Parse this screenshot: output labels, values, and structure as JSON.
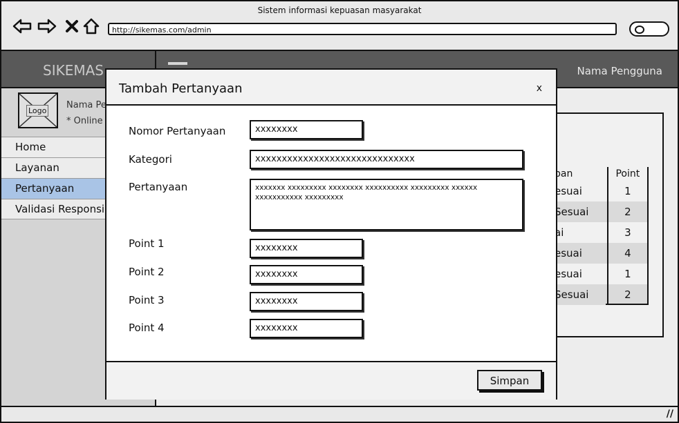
{
  "window": {
    "title": "Sistem informasi kepuasan masyarakat"
  },
  "browser": {
    "url": "http://sikemas.com/admin"
  },
  "header": {
    "brand": "SIKEMAS",
    "user_name": "Nama Pengguna"
  },
  "sidebar": {
    "logo_label": "Logo",
    "user_line1": "Nama Pengguna",
    "user_line2": "* Online",
    "items": [
      {
        "label": "Home",
        "active": false
      },
      {
        "label": "Layanan",
        "active": false
      },
      {
        "label": "Pertanyaan",
        "active": true
      },
      {
        "label": "Validasi Responsi",
        "active": false
      }
    ]
  },
  "table": {
    "headers": [
      "pan",
      "Point"
    ],
    "rows": [
      [
        "esuai",
        "1"
      ],
      [
        "Sesuai",
        "2"
      ],
      [
        "ai",
        "3"
      ],
      [
        "esuai",
        "4"
      ],
      [
        "esuai",
        "1"
      ],
      [
        "Sesuai",
        "2"
      ]
    ]
  },
  "modal": {
    "title": "Tambah Pertanyaan",
    "close": "x",
    "fields": {
      "nomor_label": "Nomor Pertanyaan",
      "nomor_value": "xxxxxxxx",
      "kategori_label": "Kategori",
      "kategori_value": "xxxxxxxxxxxxxxxxxxxxxxxxxxxxxx",
      "pertanyaan_label": "Pertanyaan",
      "pertanyaan_value": "xxxxxxx xxxxxxxxx xxxxxxxx xxxxxxxxxx xxxxxxxxx xxxxxx xxxxxxxxxxx xxxxxxxxx",
      "point1_label": "Point 1",
      "point1_value": "xxxxxxxx",
      "point2_label": "Point 2",
      "point2_value": "xxxxxxxx",
      "point3_label": "Point 3",
      "point3_value": "xxxxxxxx",
      "point4_label": "Point 4",
      "point4_value": "xxxxxxxx"
    },
    "save_label": "Simpan"
  },
  "icons": {
    "back": "arrow-left-icon",
    "forward": "arrow-right-icon",
    "stop": "close-icon",
    "home": "home-icon",
    "search": "search-icon",
    "resize": "resize-grip-icon"
  }
}
